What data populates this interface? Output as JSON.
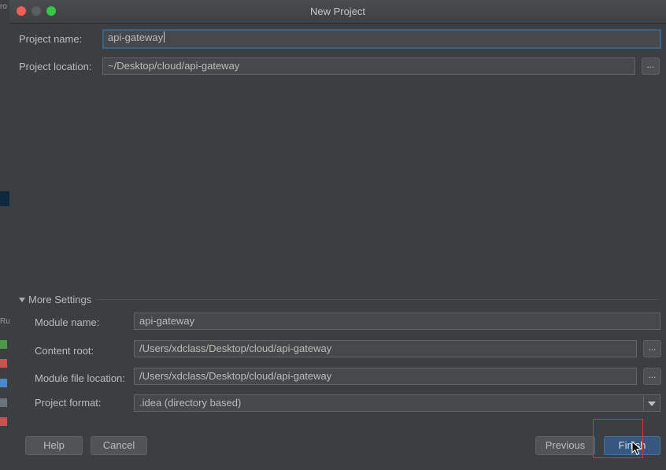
{
  "window": {
    "title": "New Project"
  },
  "project": {
    "name_label": "Project name:",
    "name_value": "api-gateway",
    "location_label": "Project location:",
    "location_value": "~/Desktop/cloud/api-gateway",
    "browse_label": "..."
  },
  "more_settings": {
    "label": "More Settings",
    "module_name_label": "Module name:",
    "module_name_value": "api-gateway",
    "content_root_label": "Content root:",
    "content_root_value": "/Users/xdclass/Desktop/cloud/api-gateway",
    "module_file_label": "Module file location:",
    "module_file_value": "/Users/xdclass/Desktop/cloud/api-gateway",
    "format_label": "Project format:",
    "format_value": ".idea (directory based)",
    "browse_label": "..."
  },
  "buttons": {
    "help": "Help",
    "cancel": "Cancel",
    "previous": "Previous",
    "finish": "Finish"
  },
  "background_ide": {
    "glyph_a": "ro",
    "glyph_b": "Ru"
  },
  "colors": {
    "accent": "#365880",
    "focus_border": "#3d6185",
    "highlight": "#e2312a",
    "dialog_bg": "#3c3f41"
  }
}
